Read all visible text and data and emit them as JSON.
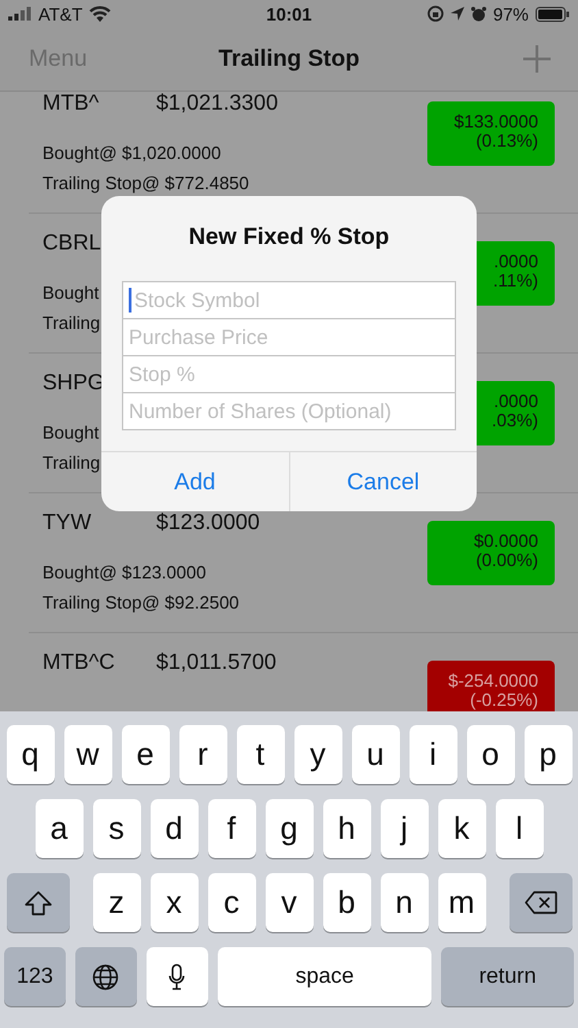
{
  "status_bar": {
    "carrier": "AT&T",
    "time": "10:01",
    "battery": "97%"
  },
  "nav": {
    "menu": "Menu",
    "title": "Trailing Stop"
  },
  "stocks": [
    {
      "symbol": "MTB^",
      "price": "$1,021.3300",
      "bought": "Bought@ $1,020.0000",
      "stop": "Trailing Stop@ $772.4850",
      "change": "$133.0000",
      "percent": "(0.13%)",
      "color": "#00a300"
    },
    {
      "symbol": "CBRL",
      "bought": "Bought",
      "stop": "Trailing",
      "change": ".0000",
      "percent": ".11%)",
      "color": "#00a300"
    },
    {
      "symbol": "SHPG",
      "bought": "Bought",
      "stop": "Trailing",
      "change": ".0000",
      "percent": ".03%)",
      "color": "#00a300"
    },
    {
      "symbol": "TYW",
      "price": "$123.0000",
      "bought": "Bought@ $123.0000",
      "stop": "Trailing Stop@ $92.2500",
      "change": "$0.0000",
      "percent": "(0.00%)",
      "color": "#00a300"
    },
    {
      "symbol": "MTB^C",
      "price": "$1,011.5700",
      "change": "$-254.0000",
      "percent": "(-0.25%)",
      "color": "#a30000"
    }
  ],
  "dialog": {
    "title": "New Fixed % Stop",
    "fields": [
      {
        "placeholder": "Stock Symbol",
        "focused": true
      },
      {
        "placeholder": "Purchase Price",
        "focused": false
      },
      {
        "placeholder": "Stop %",
        "focused": false
      },
      {
        "placeholder": "Number of Shares (Optional)",
        "focused": false
      }
    ],
    "buttons": [
      "Add",
      "Cancel"
    ]
  },
  "keyboard": [
    [
      {
        "kind": "char",
        "label": "q"
      },
      {
        "kind": "char",
        "label": "w"
      },
      {
        "kind": "char",
        "label": "e"
      },
      {
        "kind": "char",
        "label": "r"
      },
      {
        "kind": "char",
        "label": "t"
      },
      {
        "kind": "char",
        "label": "y"
      },
      {
        "kind": "char",
        "label": "u"
      },
      {
        "kind": "char",
        "label": "i"
      },
      {
        "kind": "char",
        "label": "o"
      },
      {
        "kind": "char",
        "label": "p"
      }
    ],
    [
      {
        "kind": "char",
        "label": "a"
      },
      {
        "kind": "char",
        "label": "s"
      },
      {
        "kind": "char",
        "label": "d"
      },
      {
        "kind": "char",
        "label": "f"
      },
      {
        "kind": "char",
        "label": "g"
      },
      {
        "kind": "char",
        "label": "h"
      },
      {
        "kind": "char",
        "label": "j"
      },
      {
        "kind": "char",
        "label": "k"
      },
      {
        "kind": "char",
        "label": "l"
      }
    ],
    [
      {
        "kind": "shift"
      },
      {
        "kind": "char",
        "label": "z"
      },
      {
        "kind": "char",
        "label": "x"
      },
      {
        "kind": "char",
        "label": "c"
      },
      {
        "kind": "char",
        "label": "v"
      },
      {
        "kind": "char",
        "label": "b"
      },
      {
        "kind": "char",
        "label": "n"
      },
      {
        "kind": "char",
        "label": "m"
      },
      {
        "kind": "delete"
      }
    ],
    [
      {
        "kind": "mode",
        "label": "123"
      },
      {
        "kind": "globe"
      },
      {
        "kind": "mic"
      },
      {
        "kind": "space",
        "label": "space"
      },
      {
        "kind": "return",
        "label": "return"
      }
    ]
  ]
}
